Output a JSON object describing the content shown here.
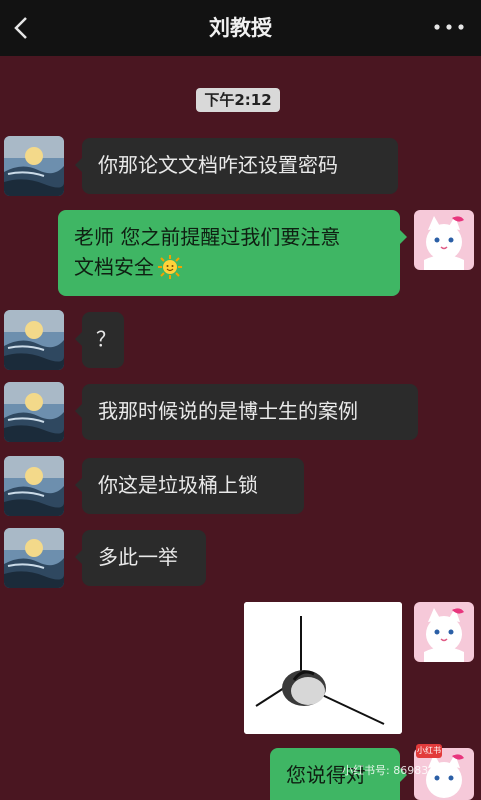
{
  "header": {
    "title": "刘教授",
    "back_icon": "back-chevron-icon",
    "more_icon": "more-dots-icon"
  },
  "timestamp": "下午2:12",
  "messages": [
    {
      "side": "left",
      "text": "你那论文文档咋还设置密码"
    },
    {
      "side": "right",
      "text_line1": "老师 您之前提醒过我们要注意",
      "text_line2": "文档安全",
      "emoji": "sun-smile-emoji"
    },
    {
      "side": "left",
      "text": "？"
    },
    {
      "side": "left",
      "text": "我那时候说的是博士生的案例"
    },
    {
      "side": "left",
      "text": "你这是垃圾桶上锁"
    },
    {
      "side": "left",
      "text": "多此一举"
    },
    {
      "side": "right",
      "type": "image",
      "image": "locked-trash-can-image"
    },
    {
      "side": "right",
      "text": "您说得对"
    }
  ],
  "watermark": {
    "logo_text": "小红书",
    "text": "小红书号: 86983"
  },
  "colors": {
    "background": "#4a1621",
    "left_bubble": "#2b2b2b",
    "right_bubble": "#3fb664",
    "topbar": "#121212"
  }
}
